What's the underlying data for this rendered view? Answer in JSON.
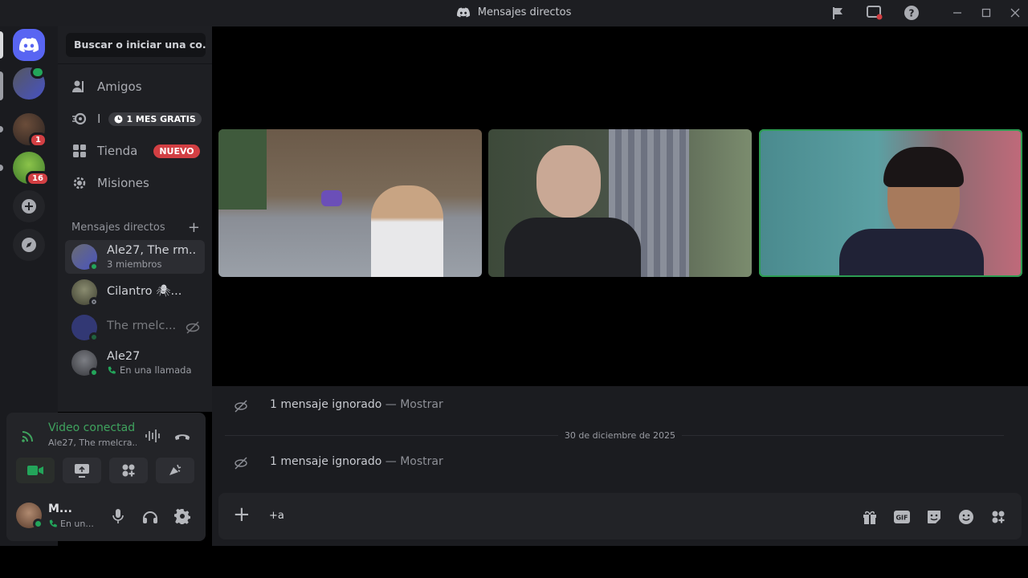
{
  "window": {
    "title": "Mensajes directos"
  },
  "sidebar": {
    "search_placeholder": "Buscar o iniciar una co...",
    "nav": [
      {
        "label": "Amigos",
        "icon": "friends-icon"
      },
      {
        "label": "I",
        "icon": "nitro-icon",
        "tag": "1 MES GRATIS"
      },
      {
        "label": "Tienda",
        "icon": "shop-icon",
        "tag": "NUEVO"
      },
      {
        "label": "Misiones",
        "icon": "quests-icon"
      }
    ],
    "dm_header": "Mensajes directos",
    "dms": [
      {
        "name": "Ale27, The rm...",
        "sub": "3 miembros"
      },
      {
        "name": "Cilantro 🕷...",
        "sub": ""
      },
      {
        "name": "The rmelc...",
        "sub": ""
      },
      {
        "name": "Ale27",
        "sub": "En una llamada"
      }
    ]
  },
  "rail": {
    "badges": [
      "1",
      "16"
    ]
  },
  "voice": {
    "title": "Video conectado",
    "subtitle": "Ale27, The rmelcra..."
  },
  "user": {
    "name": "M...",
    "status": "En un..."
  },
  "chat": {
    "ignored_1": "1 mensaje ignorado",
    "show_1": "Mostrar",
    "date": "30 de diciembre de 2025",
    "ignored_2": "1 mensaje ignorado",
    "show_2": "Mostrar",
    "dash": " — ",
    "input_value": "+a"
  },
  "colors": {
    "accent": "#5865f2",
    "online": "#23a55a",
    "danger": "#d23f43",
    "speaking": "#3fa35e"
  }
}
